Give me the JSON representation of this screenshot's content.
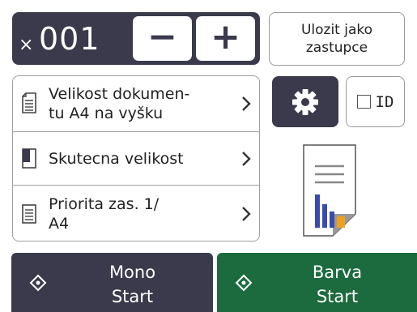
{
  "copies": {
    "times_symbol": "×",
    "count": "001",
    "minus_label": "−",
    "plus_label": "+"
  },
  "save_button": {
    "label": "Ulozit jako\nzastupce"
  },
  "settings": [
    {
      "label": "Velikost dokumen-\ntu A4 na vyšku",
      "icon": "document-size-icon"
    },
    {
      "label": "Skutecna velikost",
      "icon": "page-layout-icon"
    },
    {
      "label": "Priorita zas. 1/\nA4",
      "icon": "tray-priority-icon"
    }
  ],
  "id_button": {
    "label": "ID"
  },
  "start": {
    "mono": {
      "label": "Mono\nStart"
    },
    "color": {
      "label": "Barva\nStart"
    }
  },
  "colors": {
    "dark": "#3a3a4c",
    "green": "#1c6b3e",
    "chart_blue": "#3a4bb0",
    "chart_orange": "#f0a020"
  }
}
